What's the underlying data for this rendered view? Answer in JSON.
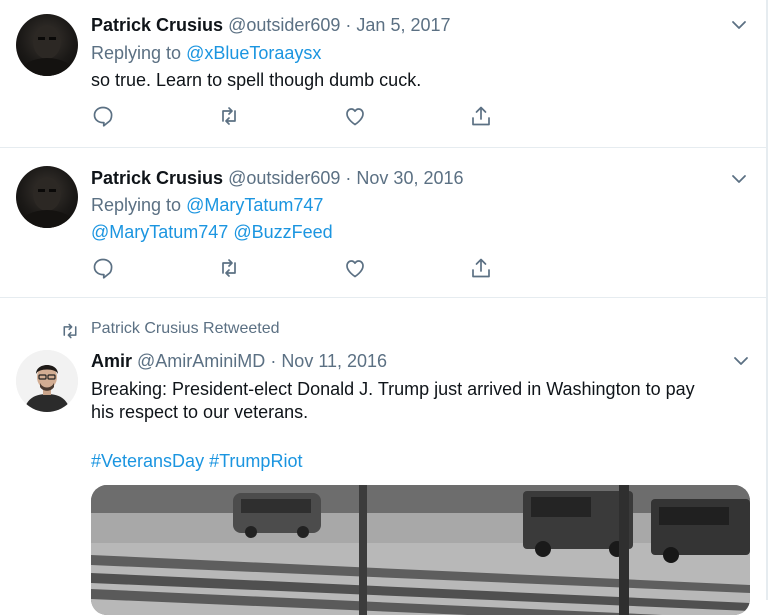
{
  "tweets": [
    {
      "name": "Patrick Crusius",
      "handle": "@outsider609",
      "date": "Jan 5, 2017",
      "reply_prefix": "Replying to ",
      "reply_to": "@xBlueToraaysx",
      "text": "so true. Learn to spell though dumb cuck."
    },
    {
      "name": "Patrick Crusius",
      "handle": "@outsider609",
      "date": "Nov 30, 2016",
      "reply_prefix": "Replying to ",
      "reply_to": "@MaryTatum747",
      "mention_1": "@MaryTatum747",
      "mention_2": "@BuzzFeed"
    },
    {
      "retweet_label": "Patrick Crusius Retweeted",
      "name": "Amir",
      "handle": "@AmirAminiMD",
      "date": "Nov 11, 2016",
      "text_line_1": "Breaking: President-elect Donald J. Trump just arrived in Washington to pay",
      "text_line_2": "his respect to our veterans.",
      "hashtag_1": "#VeteransDay",
      "hashtag_2": "#TrumpRiot"
    }
  ],
  "separator": " · ",
  "icons": {
    "reply": "reply-icon",
    "retweet": "retweet-icon",
    "like": "like-icon",
    "share": "share-icon",
    "more": "chevron-down-icon"
  },
  "colors": {
    "link": "#1b95e0",
    "muted": "#5b7083",
    "text": "#0f1419",
    "divider": "#e6ecf0"
  }
}
